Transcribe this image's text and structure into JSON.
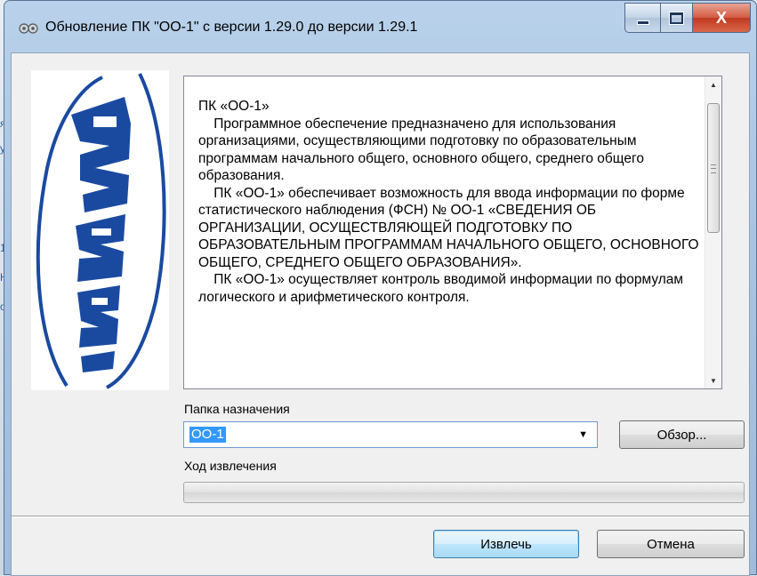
{
  "window": {
    "title": "Обновление ПК \"ОО-1\" с версии 1.29.0 до версии 1.29.1"
  },
  "caption_buttons": {
    "close_glyph": "X"
  },
  "background": {
    "letters": [
      "я",
      "у",
      "1",
      "Н",
      "о"
    ]
  },
  "description": {
    "paragraphs": [
      "ПК «ОО-1»",
      "    Программное обеспечение предназначено для использования организациями, осуществляющими подготовку по образовательным программам начального общего, основного общего, среднего общего образования.",
      "    ПК «ОО-1» обеспечивает возможность для ввода информации по форме статистического наблюдения (ФСН) № ОО-1 «СВЕДЕНИЯ ОБ ОРГАНИЗАЦИИ, ОСУЩЕСТВЛЯЮЩЕЙ ПОДГОТОВКУ ПО ОБРАЗОВАТЕЛЬНЫМ ПРОГРАММАМ НАЧАЛЬНОГО ОБЩЕГО, ОСНОВНОГО ОБЩЕГО, СРЕДНЕГО ОБЩЕГО ОБРАЗОВАНИЯ».",
      "    ПК «ОО-1» осуществляет контроль вводимой информации по формулам логического и арифметического контроля."
    ]
  },
  "destination": {
    "label": "Папка назначения",
    "value": "ОО-1",
    "browse_label": "Обзор..."
  },
  "progress": {
    "label": "Ход извлечения",
    "fraction": 0
  },
  "actions": {
    "extract_label": "Извлечь",
    "cancel_label": "Отмена"
  },
  "colors": {
    "logo_blue": "#1a4aa0",
    "selection": "#3399ff"
  }
}
